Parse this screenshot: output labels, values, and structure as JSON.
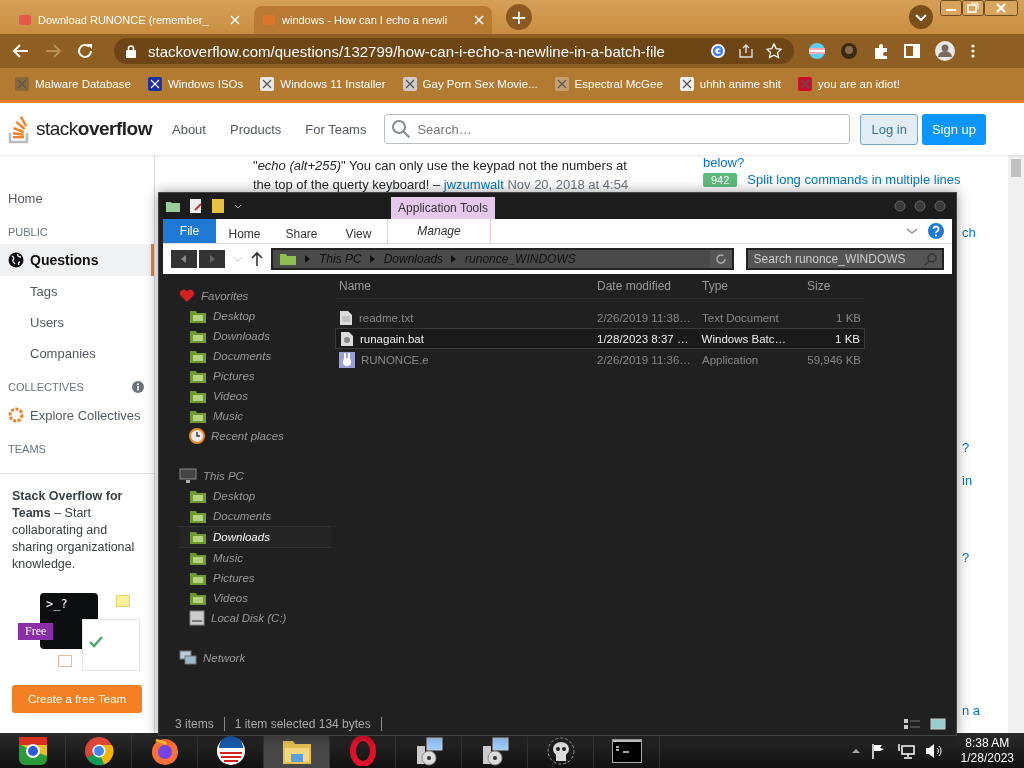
{
  "browser": {
    "tabs": [
      {
        "title": "Download RUNONCE (remember_",
        "selected": false
      },
      {
        "title": "windows - How can I echo a newli",
        "selected": true
      }
    ],
    "new_tab": "+",
    "forward_disabled": true,
    "url": "stackoverflow.com/questions/132799/how-can-i-echo-a-newline-in-a-batch-file",
    "bookmarks": [
      "Malware Database",
      "Windows ISOs",
      "Windows 11 Installer",
      "Gay Porn Sex Movie...",
      "Espectral McGee",
      "uhhh anime shit",
      "you are an idiot!"
    ]
  },
  "site": {
    "logo": "stack**overflow**",
    "nav": [
      "About",
      "Products",
      "For Teams"
    ],
    "search_placeholder": "Search…",
    "login": "Log in",
    "signup": "Sign up",
    "sidebar": [
      {
        "kind": "link",
        "label": "Home",
        "selected": false
      },
      {
        "kind": "heading",
        "label": "PUBLIC"
      },
      {
        "kind": "globe-link",
        "label": "Questions",
        "selected": true
      },
      {
        "kind": "sublink",
        "label": "Tags",
        "selected": false
      },
      {
        "kind": "sublink",
        "label": "Users",
        "selected": false
      },
      {
        "kind": "sublink",
        "label": "Companies",
        "selected": false
      },
      {
        "kind": "info-heading",
        "label": "COLLECTIVES"
      },
      {
        "kind": "collective-link",
        "label": "Explore Collectives",
        "selected": false
      },
      {
        "kind": "heading",
        "label": "TEAMS"
      }
    ],
    "teams_card": {
      "text": "**Stack Overflow for Teams** – Start collaborating and sharing organizational knowledge.",
      "prompt": ">_?",
      "badge": "Free",
      "button": "Create a free Team"
    },
    "comment": {
      "text": "\"*echo (alt+255)*\" You can only use the keypad not the numbers at the top of the querty keyboard! –",
      "author": "jwzumwalt",
      "date": "Nov 20, 2018 at 4:54"
    },
    "related": [
      {
        "text": "below?"
      },
      {
        "votes": "942",
        "text": "Split long commands in multiple lines"
      }
    ],
    "related_fragments": [
      "ch",
      "?",
      "in",
      "?",
      "n a"
    ]
  },
  "explorer": {
    "context_tab": "Application Tools",
    "ribbon_tabs": [
      {
        "label": "File",
        "kind": "file"
      },
      {
        "label": "Home",
        "kind": "tab"
      },
      {
        "label": "Share",
        "kind": "tab"
      },
      {
        "label": "View",
        "kind": "tab"
      },
      {
        "label": "Manage",
        "kind": "context"
      }
    ],
    "breadcrumb": [
      "This PC",
      "Downloads",
      "runonce_WINDOWS"
    ],
    "search_placeholder": "Search runonce_WINDOWS",
    "nav": [
      {
        "label": "Favorites",
        "kind": "favorites",
        "selected": false,
        "children": [
          {
            "label": "Desktop",
            "kind": "desktop",
            "selected": false
          },
          {
            "label": "Downloads",
            "kind": "downloads",
            "selected": false
          },
          {
            "label": "Documents",
            "kind": "documents",
            "selected": false
          },
          {
            "label": "Pictures",
            "kind": "pictures",
            "selected": false
          },
          {
            "label": "Videos",
            "kind": "videos",
            "selected": false
          },
          {
            "label": "Music",
            "kind": "music",
            "selected": false
          },
          {
            "label": "Recent places",
            "kind": "recent",
            "selected": false
          }
        ]
      },
      {
        "label": "This PC",
        "kind": "pc",
        "selected": false,
        "children": [
          {
            "label": "Desktop",
            "kind": "desktop",
            "selected": false
          },
          {
            "label": "Documents",
            "kind": "documents",
            "selected": false
          },
          {
            "label": "Downloads",
            "kind": "downloads",
            "selected": true
          },
          {
            "label": "Music",
            "kind": "music",
            "selected": false
          },
          {
            "label": "Pictures",
            "kind": "pictures",
            "selected": false
          },
          {
            "label": "Videos",
            "kind": "videos",
            "selected": false
          },
          {
            "label": "Local Disk (C:)",
            "kind": "disk",
            "selected": false
          }
        ]
      },
      {
        "label": "Network",
        "kind": "network",
        "selected": false
      }
    ],
    "columns": [
      "Name",
      "Date modified",
      "Type",
      "Size"
    ],
    "files": [
      {
        "name": "readme.txt",
        "date": "2/26/2019 11:38…",
        "type": "Text Document",
        "size": "1 KB",
        "kind": "text",
        "selected": false
      },
      {
        "name": "runagain.bat",
        "date": "1/28/2023 8:37 …",
        "type": "Windows Batc…",
        "size": "1 KB",
        "kind": "batch",
        "selected": true
      },
      {
        "name": "RUNONCE.e",
        "date": "2/26/2019 11:36…",
        "type": "Application",
        "size": "59,946 KB",
        "kind": "app",
        "selected": false
      }
    ],
    "status": [
      "3 items",
      "1 item selected 134 bytes"
    ]
  },
  "taskbar": {
    "items": [
      {
        "kind": "chromium",
        "active": false
      },
      {
        "kind": "chrome",
        "active": false
      },
      {
        "kind": "firefox",
        "active": false
      },
      {
        "kind": "stripes",
        "active": false
      },
      {
        "kind": "explorer",
        "active": true
      },
      {
        "kind": "opera",
        "active": false
      },
      {
        "kind": "installer",
        "active": false
      },
      {
        "kind": "installer",
        "active": false
      },
      {
        "kind": "skull",
        "active": false
      },
      {
        "kind": "terminal",
        "active": false
      }
    ],
    "time": "8:38 AM",
    "date": "1/28/2023"
  }
}
